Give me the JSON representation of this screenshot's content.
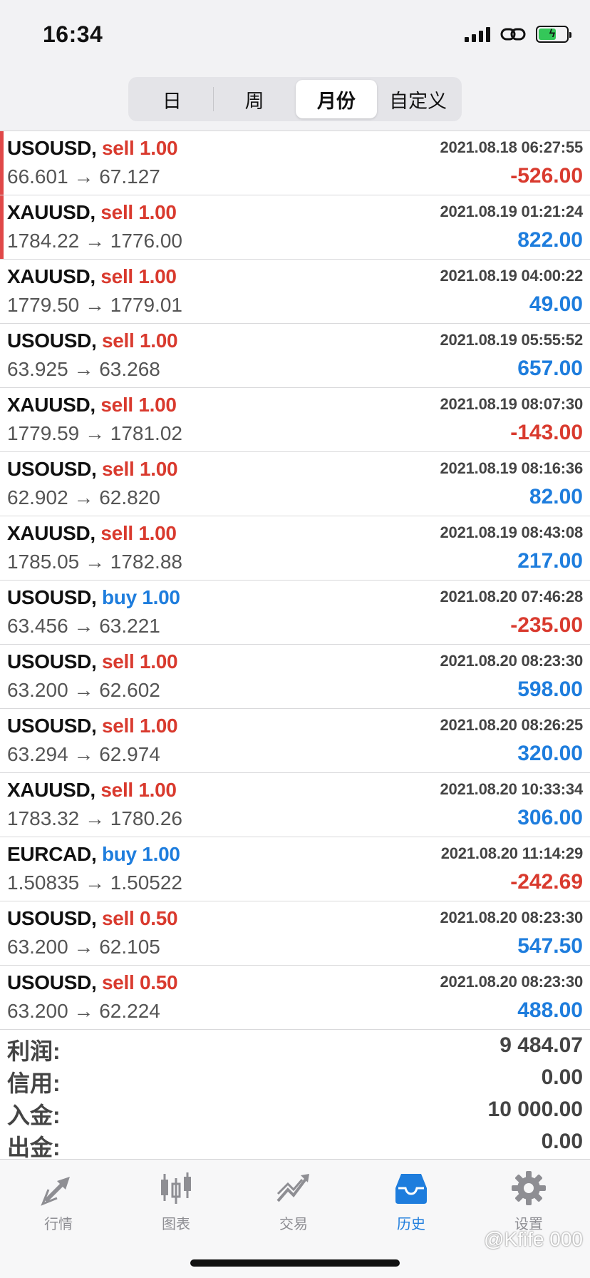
{
  "status_bar": {
    "time": "16:34"
  },
  "segments": [
    {
      "label": "日",
      "active": false
    },
    {
      "label": "周",
      "active": false
    },
    {
      "label": "月份",
      "active": true
    },
    {
      "label": "自定义",
      "active": false
    }
  ],
  "deals": [
    {
      "symbol": "USOUSD,",
      "side": "sell 1.00",
      "type": "sell",
      "time": "2021.08.18 06:27:55",
      "prices": "66.601 → 67.127",
      "profit": "-526.00",
      "sign": "neg"
    },
    {
      "symbol": "XAUUSD,",
      "side": "sell 1.00",
      "type": "sell",
      "time": "2021.08.19 01:21:24",
      "prices": "1784.22 → 1776.00",
      "profit": "822.00",
      "sign": "pos"
    },
    {
      "symbol": "XAUUSD,",
      "side": "sell 1.00",
      "type": "sell",
      "time": "2021.08.19 04:00:22",
      "prices": "1779.50 → 1779.01",
      "profit": "49.00",
      "sign": "pos"
    },
    {
      "symbol": "USOUSD,",
      "side": "sell 1.00",
      "type": "sell",
      "time": "2021.08.19 05:55:52",
      "prices": "63.925 → 63.268",
      "profit": "657.00",
      "sign": "pos"
    },
    {
      "symbol": "XAUUSD,",
      "side": "sell 1.00",
      "type": "sell",
      "time": "2021.08.19 08:07:30",
      "prices": "1779.59 → 1781.02",
      "profit": "-143.00",
      "sign": "neg"
    },
    {
      "symbol": "USOUSD,",
      "side": "sell 1.00",
      "type": "sell",
      "time": "2021.08.19 08:16:36",
      "prices": "62.902 → 62.820",
      "profit": "82.00",
      "sign": "pos"
    },
    {
      "symbol": "XAUUSD,",
      "side": "sell 1.00",
      "type": "sell",
      "time": "2021.08.19 08:43:08",
      "prices": "1785.05 → 1782.88",
      "profit": "217.00",
      "sign": "pos"
    },
    {
      "symbol": "USOUSD,",
      "side": "buy 1.00",
      "type": "buy",
      "time": "2021.08.20 07:46:28",
      "prices": "63.456 → 63.221",
      "profit": "-235.00",
      "sign": "neg"
    },
    {
      "symbol": "USOUSD,",
      "side": "sell 1.00",
      "type": "sell",
      "time": "2021.08.20 08:23:30",
      "prices": "63.200 → 62.602",
      "profit": "598.00",
      "sign": "pos"
    },
    {
      "symbol": "USOUSD,",
      "side": "sell 1.00",
      "type": "sell",
      "time": "2021.08.20 08:26:25",
      "prices": "63.294 → 62.974",
      "profit": "320.00",
      "sign": "pos"
    },
    {
      "symbol": "XAUUSD,",
      "side": "sell 1.00",
      "type": "sell",
      "time": "2021.08.20 10:33:34",
      "prices": "1783.32 → 1780.26",
      "profit": "306.00",
      "sign": "pos"
    },
    {
      "symbol": "EURCAD,",
      "side": "buy 1.00",
      "type": "buy",
      "time": "2021.08.20 11:14:29",
      "prices": "1.50835 → 1.50522",
      "profit": "-242.69",
      "sign": "neg"
    },
    {
      "symbol": "USOUSD,",
      "side": "sell 0.50",
      "type": "sell",
      "time": "2021.08.20 08:23:30",
      "prices": "63.200 → 62.105",
      "profit": "547.50",
      "sign": "pos"
    },
    {
      "symbol": "USOUSD,",
      "side": "sell 0.50",
      "type": "sell",
      "time": "2021.08.20 08:23:30",
      "prices": "63.200 → 62.224",
      "profit": "488.00",
      "sign": "pos"
    }
  ],
  "summary": [
    {
      "label": "利润:",
      "value": "9 484.07"
    },
    {
      "label": "信用:",
      "value": "0.00"
    },
    {
      "label": "入金:",
      "value": "10 000.00"
    },
    {
      "label": "出金:",
      "value": "0.00"
    }
  ],
  "tabbar": [
    {
      "label": "行情",
      "icon": "quotes-arrows-icon",
      "active": false
    },
    {
      "label": "图表",
      "icon": "candlestick-chart-icon",
      "active": false
    },
    {
      "label": "交易",
      "icon": "trade-chart-icon",
      "active": false
    },
    {
      "label": "历史",
      "icon": "history-inbox-icon",
      "active": true
    },
    {
      "label": "设置",
      "icon": "gear-icon",
      "active": false
    }
  ],
  "watermark": "@Kfife 000",
  "colors": {
    "sell": "#d93a2e",
    "buy": "#1e7ddd",
    "active_tab": "#1e7ddd",
    "inactive_tab": "#8e8e93"
  }
}
